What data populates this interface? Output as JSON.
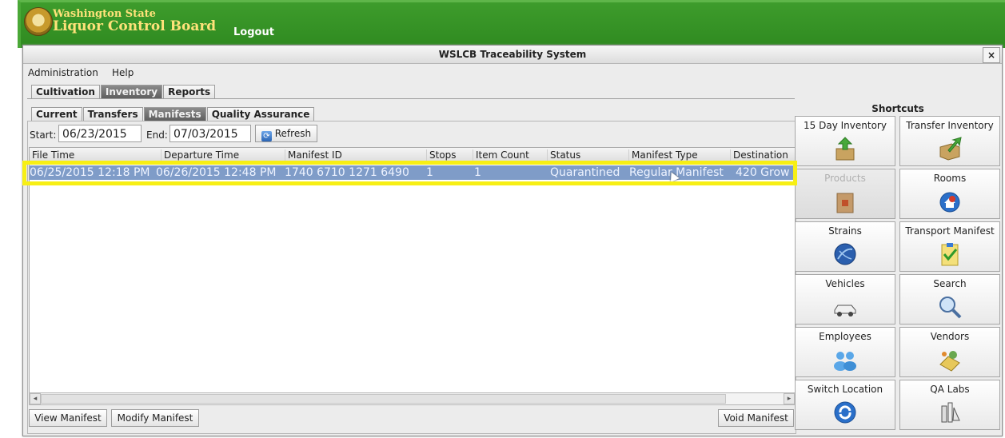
{
  "header": {
    "brand_line1": "Washington State",
    "brand_line2": "Liquor Control Board",
    "logout": "Logout"
  },
  "window": {
    "title": "WSLCB Traceability System",
    "close": "×"
  },
  "menu": [
    "Administration",
    "Help"
  ],
  "main_tabs": [
    {
      "label": "Cultivation",
      "active": false
    },
    {
      "label": "Inventory",
      "active": true
    },
    {
      "label": "Reports",
      "active": false
    }
  ],
  "sub_tabs": [
    {
      "label": "Current",
      "active": false
    },
    {
      "label": "Transfers",
      "active": false
    },
    {
      "label": "Manifests",
      "active": true
    },
    {
      "label": "Quality Assurance",
      "active": false
    }
  ],
  "filters": {
    "start_label": "Start:",
    "start_value": "06/23/2015",
    "end_label": "End:",
    "end_value": "07/03/2015",
    "refresh": "Refresh"
  },
  "table": {
    "columns": [
      "File Time",
      "Departure Time",
      "Manifest ID",
      "Stops",
      "Item Count",
      "Status",
      "Manifest Type",
      "Destination"
    ],
    "rows": [
      [
        "06/25/2015 12:18 PM",
        "06/26/2015 12:48 PM",
        "1740 6710 1271 6490",
        "1",
        "1",
        "Quarantined",
        "Regular Manifest",
        "420 Grow"
      ]
    ]
  },
  "actions": {
    "view": "View Manifest",
    "modify": "Modify Manifest",
    "void": "Void Manifest"
  },
  "shortcuts": {
    "title": "Shortcuts",
    "items": [
      {
        "label": "15 Day Inventory",
        "icon": "inventory-box-icon",
        "enabled": true
      },
      {
        "label": "Transfer Inventory",
        "icon": "transfer-box-icon",
        "enabled": true
      },
      {
        "label": "Products",
        "icon": "products-box-icon",
        "enabled": false
      },
      {
        "label": "Rooms",
        "icon": "rooms-icon",
        "enabled": true
      },
      {
        "label": "Strains",
        "icon": "strains-globe-icon",
        "enabled": true
      },
      {
        "label": "Transport Manifest",
        "icon": "clipboard-icon",
        "enabled": true
      },
      {
        "label": "Vehicles",
        "icon": "car-icon",
        "enabled": true
      },
      {
        "label": "Search",
        "icon": "magnifier-icon",
        "enabled": true
      },
      {
        "label": "Employees",
        "icon": "people-icon",
        "enabled": true
      },
      {
        "label": "Vendors",
        "icon": "vendors-icon",
        "enabled": true
      },
      {
        "label": "Switch Location",
        "icon": "switch-location-icon",
        "enabled": true
      },
      {
        "label": "QA Labs",
        "icon": "lab-icon",
        "enabled": true
      }
    ]
  },
  "colors": {
    "header_green": "#3e9c2c",
    "brand_text": "#ffe27a",
    "selected_row": "#7f9cc8",
    "highlight": "#f7ef14"
  }
}
